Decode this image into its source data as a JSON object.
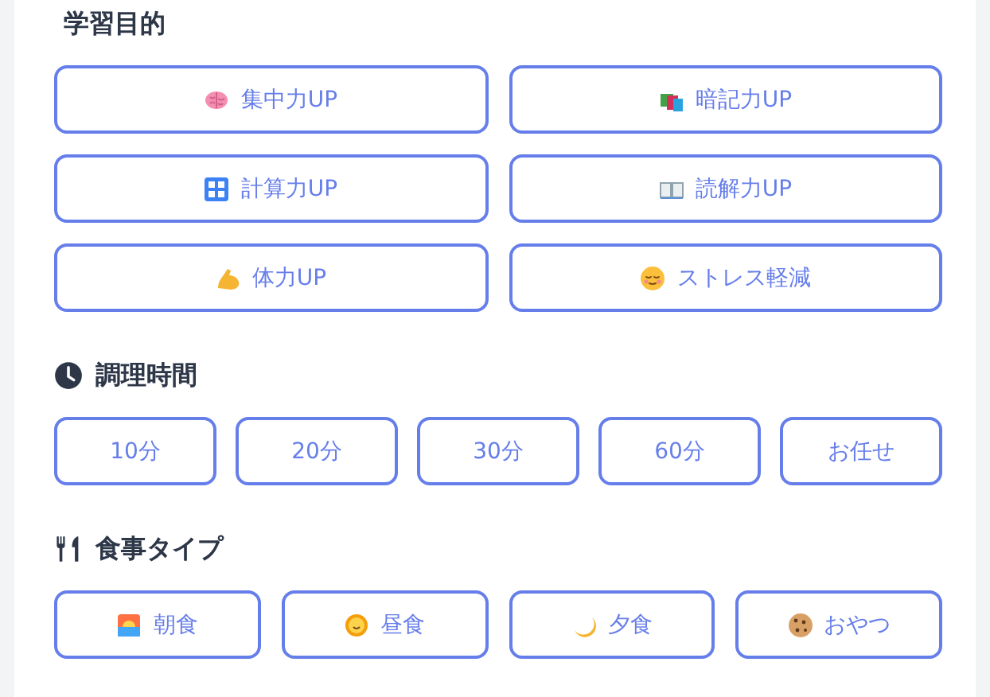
{
  "sections": [
    {
      "title": "学習目的",
      "options": [
        {
          "label": "集中力UP",
          "selected": false
        },
        {
          "label": "暗記力UP",
          "selected": false
        },
        {
          "label": "計算力UP",
          "selected": false
        },
        {
          "label": "読解力UP",
          "selected": false
        },
        {
          "label": "体力UP",
          "selected": false
        },
        {
          "label": "ストレス軽減",
          "selected": false
        }
      ]
    },
    {
      "title": "調理時間",
      "options": [
        {
          "label": "10分",
          "selected": false
        },
        {
          "label": "20分",
          "selected": false
        },
        {
          "label": "30分",
          "selected": false
        },
        {
          "label": "60分",
          "selected": false
        },
        {
          "label": "お任せ",
          "selected": false
        }
      ]
    },
    {
      "title": "食事タイプ",
      "options": [
        {
          "label": "朝食",
          "selected": false
        },
        {
          "label": "昼食",
          "selected": false
        },
        {
          "label": "夕食",
          "selected": false
        },
        {
          "label": "おやつ",
          "selected": false
        }
      ]
    }
  ]
}
